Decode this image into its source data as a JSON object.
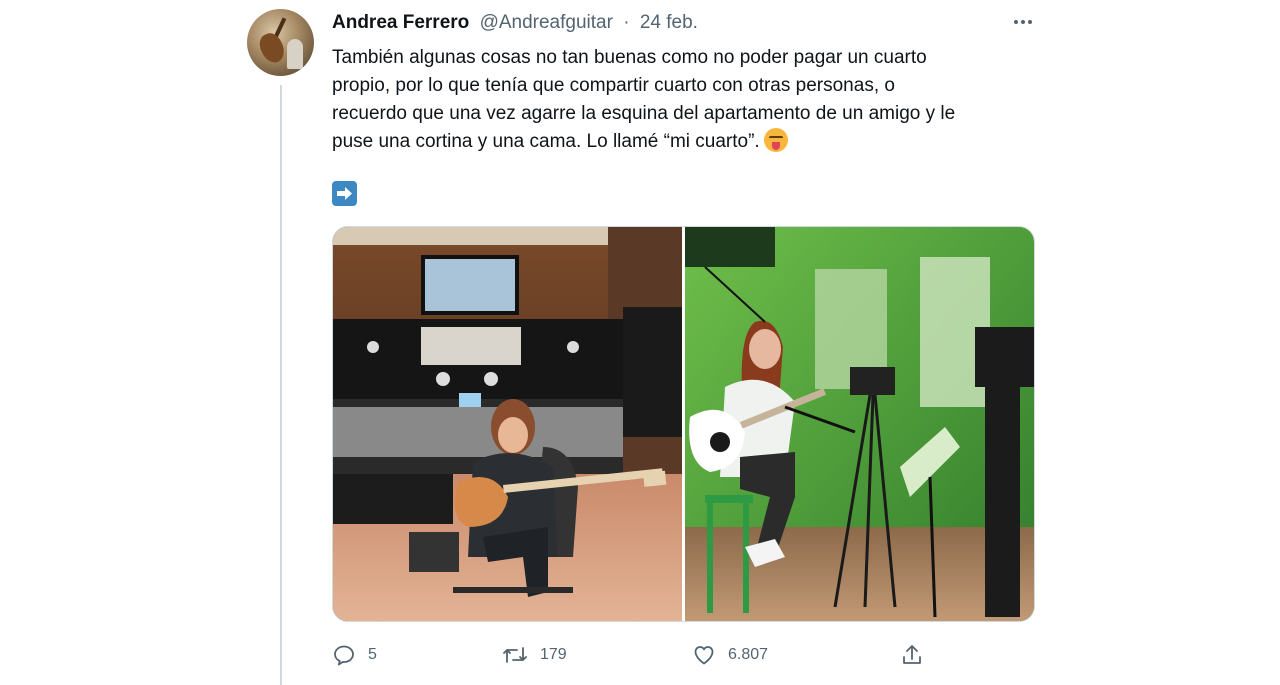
{
  "tweet": {
    "author_name": "Andrea Ferrero",
    "author_handle": "@Andreafguitar",
    "separator": "·",
    "date": "24 feb.",
    "lines": [
      "También algunas cosas no tan buenas como no poder pagar un cuarto",
      "propio, por lo que tenía que compartir cuarto con otras personas, o",
      "recuerdo que una vez agarre la esquina del apartamento de un amigo y le",
      "puse una cortina y una cama. Lo llamé “mi cuarto”."
    ],
    "emoji": "squinting-face-with-tongue",
    "arrow_emoji": "right-arrow-emoji",
    "media": [
      {
        "name": "studio-console-photo",
        "description_icon": "photo"
      },
      {
        "name": "green-studio-photo",
        "description_icon": "photo"
      }
    ],
    "actions": {
      "replies": "5",
      "retweets": "179",
      "likes": "6.807"
    }
  },
  "colors": {
    "text": "#0f1419",
    "secondary": "#536471",
    "thread_line": "#cfd9de",
    "arrow_blue": "#3b88c3"
  }
}
